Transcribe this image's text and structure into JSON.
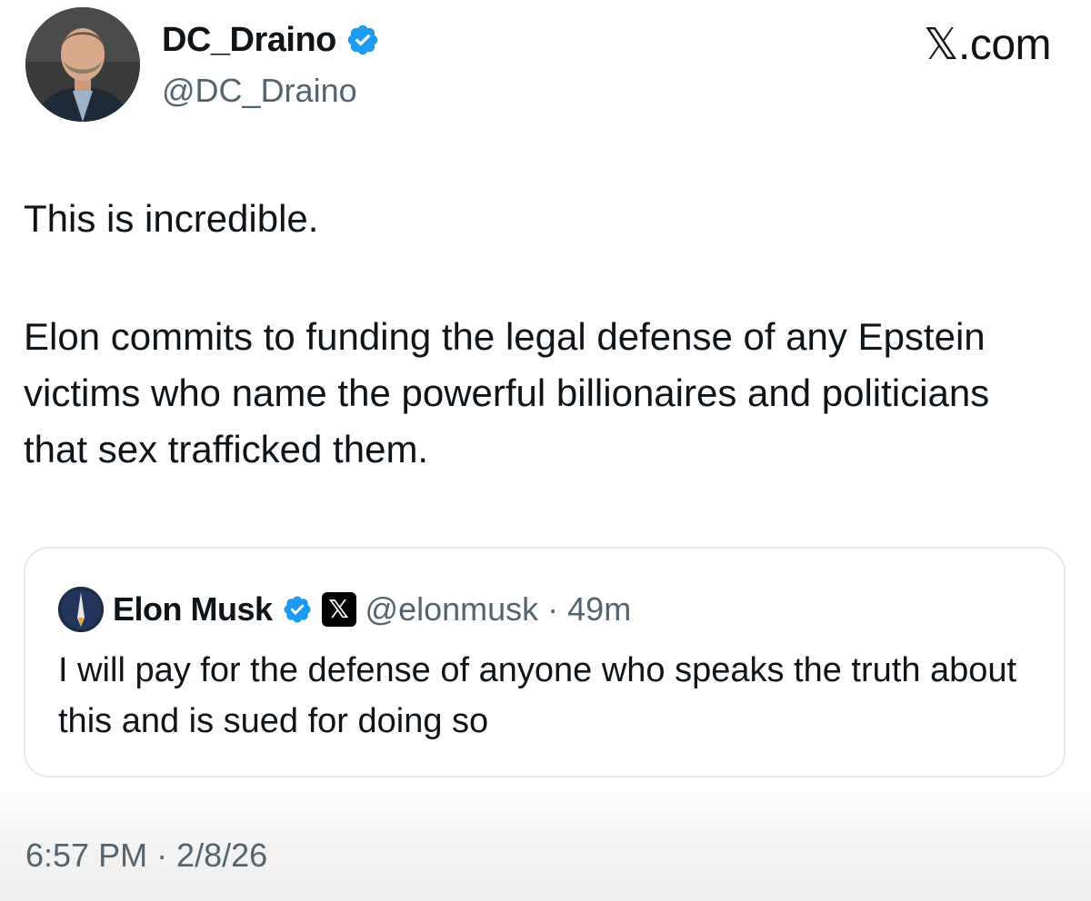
{
  "author": {
    "display_name": "DC_Draino",
    "handle": "@DC_Draino",
    "verified": true
  },
  "brand": "𝕏.com",
  "tweet": {
    "line1": "This is incredible.",
    "line2": "Elon commits to funding the legal defense of any Epstein victims who name the powerful billionaires and politicians that sex trafficked them."
  },
  "quoted_tweet": {
    "display_name": "Elon Musk",
    "verified": true,
    "affiliate_badge": "𝕏",
    "handle": "@elonmusk",
    "separator": "·",
    "time": "49m",
    "text": "I will pay for the defense of anyone who speaks the truth about this and is sued for doing so"
  },
  "timestamp": "6:57 PM · 2/8/26",
  "colors": {
    "verified_blue": "#1d9bf0",
    "secondary_text": "#536471",
    "primary_text": "#0f1419"
  },
  "icons": {
    "verified": "verified-badge-icon",
    "x_logo": "x-logo-icon"
  }
}
